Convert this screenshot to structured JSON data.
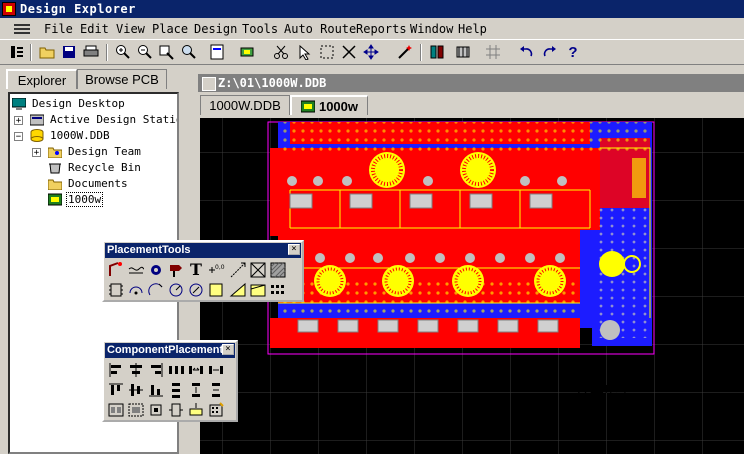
{
  "window": {
    "title": "Design Explorer"
  },
  "menu": [
    "File",
    "Edit",
    "View",
    "Place",
    "Design",
    "Tools",
    "Auto Route",
    "Reports",
    "Window",
    "Help"
  ],
  "toolbar_icons": [
    "explorer-toggle-icon",
    "open-folder-icon",
    "save-icon",
    "print-icon",
    "zoom-in-icon",
    "zoom-out-icon",
    "zoom-fit-icon",
    "zoom-area-icon",
    "sheet-icon",
    "component-icon",
    "cut-icon",
    "select-icon",
    "select-area-icon",
    "deselect-icon",
    "move-icon",
    "wand-icon",
    "library-browse-icon",
    "library-icon",
    "grid-icon",
    "undo-icon",
    "redo-icon",
    "help-icon"
  ],
  "explorer": {
    "tabs": [
      "Explorer",
      "Browse PCB"
    ],
    "tree": {
      "desktop": "Design Desktop",
      "active_servers": "Active Design Station",
      "ddb": "1000W.DDB",
      "design_team": "Design Team",
      "recycle_bin": "Recycle Bin",
      "documents": "Documents",
      "pcb": "1000w"
    }
  },
  "document": {
    "title": "Z:\\01\\1000W.DDB",
    "tabs": [
      "1000W.DDB",
      "1000w"
    ]
  },
  "placement_tools": {
    "title": "PlacementTools",
    "close": "×"
  },
  "component_placement": {
    "title": "ComponentPlacement",
    "close": "×"
  },
  "watermark": "51黑电子",
  "colors": {
    "titlebar": "#0a246a",
    "board_top": "#ff0000",
    "board_bottom": "#1c1cff",
    "silk": "#ffff00",
    "grid": "#3a3a3a",
    "outline": "#ff00ff"
  }
}
